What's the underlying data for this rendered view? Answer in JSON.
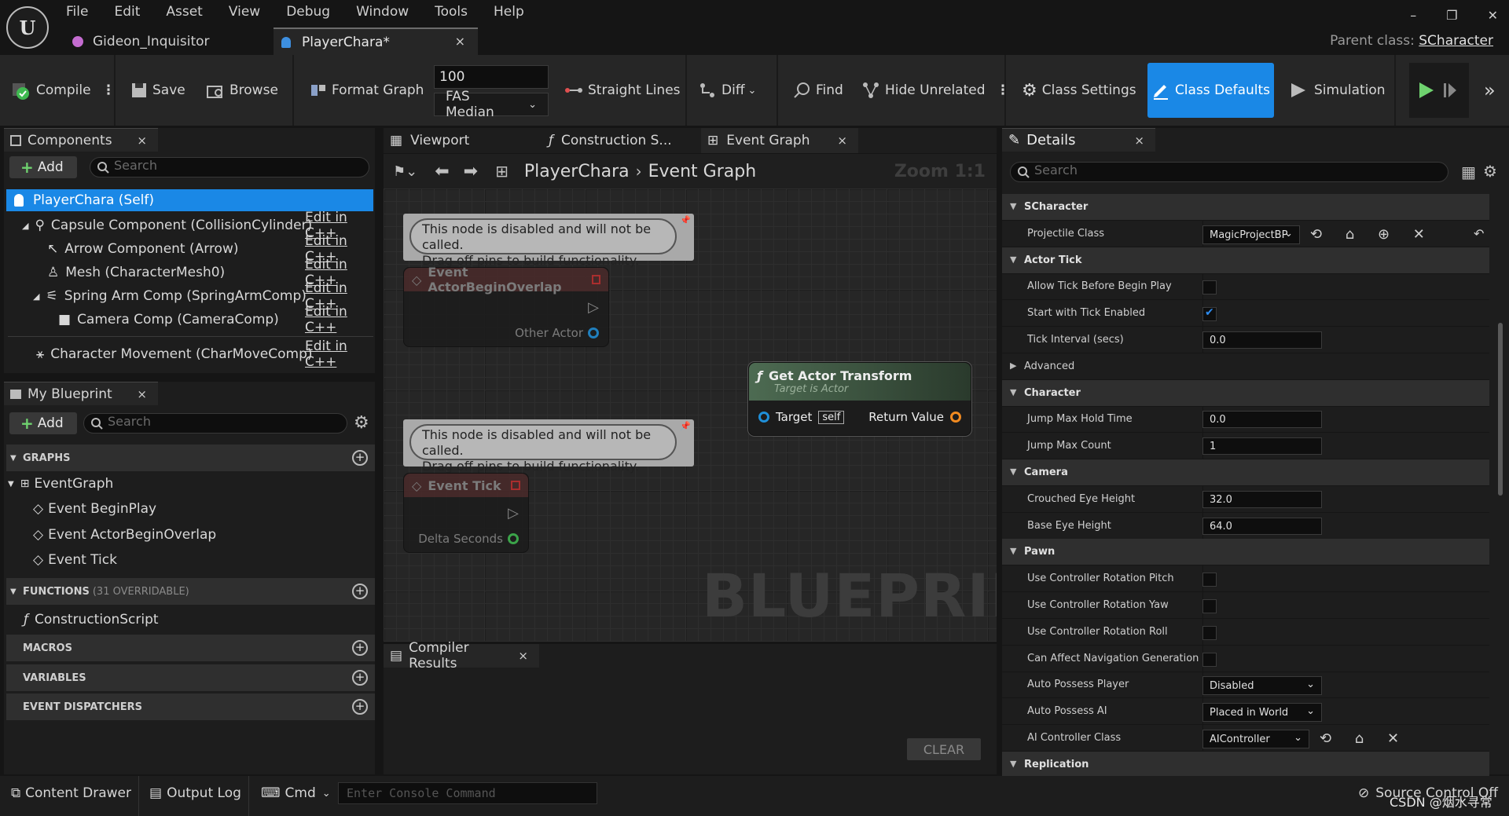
{
  "menu": [
    "File",
    "Edit",
    "Asset",
    "View",
    "Debug",
    "Window",
    "Tools",
    "Help"
  ],
  "tabs": {
    "project": "Gideon_Inquisitor",
    "asset": "PlayerChara*",
    "close_glyph": "×"
  },
  "parent_class": {
    "label": "Parent class:",
    "value": "SCharacter"
  },
  "window_controls": [
    "–",
    "❐",
    "✕"
  ],
  "toolbar": {
    "compile": "Compile",
    "save": "Save",
    "browse": "Browse",
    "format_graph": "Format Graph",
    "zoom_value": "100",
    "fas_select": "FAS Median",
    "straight_lines": "Straight Lines",
    "diff": "Diff",
    "find": "Find",
    "hide_unrelated": "Hide Unrelated",
    "class_settings": "Class Settings",
    "class_defaults": "Class Defaults",
    "simulation": "Simulation"
  },
  "components": {
    "title": "Components",
    "add": "Add",
    "search_placeholder": "Search",
    "self": "PlayerChara (Self)",
    "edit_label": "Edit in C++",
    "items": [
      "Capsule Component (CollisionCylinder)",
      "Arrow Component (Arrow)",
      "Mesh (CharacterMesh0)",
      "Spring Arm Comp (SpringArmComp)",
      "Camera Comp (CameraComp)",
      "Character Movement (CharMoveComp)"
    ]
  },
  "my_blueprint": {
    "title": "My Blueprint",
    "add": "Add",
    "search_placeholder": "Search",
    "graphs_label": "GRAPHS",
    "event_graph": "EventGraph",
    "events": [
      "Event BeginPlay",
      "Event ActorBeginOverlap",
      "Event Tick"
    ],
    "functions_label": "FUNCTIONS",
    "functions_sub": "(31 OVERRIDABLE)",
    "construction_script": "ConstructionScript",
    "macros_label": "MACROS",
    "variables_label": "VARIABLES",
    "dispatchers_label": "EVENT DISPATCHERS"
  },
  "graph": {
    "tabs": [
      "Viewport",
      "Construction S...",
      "Event Graph"
    ],
    "breadcrumb_root": "PlayerChara",
    "breadcrumb_leaf": "Event Graph",
    "zoom": "Zoom 1:1",
    "disabled_comment": "This node is disabled and will not be called.\nDrag off pins to build functionality.",
    "node_overlap": {
      "title": "Event ActorBeginOverlap",
      "pin": "Other Actor"
    },
    "node_tick": {
      "title": "Event Tick",
      "pin": "Delta Seconds"
    },
    "node_transform": {
      "title": "Get Actor Transform",
      "subtitle": "Target is Actor",
      "target": "Target",
      "self": "self",
      "return": "Return Value"
    },
    "watermark": "BLUEPRINT"
  },
  "compiler": {
    "title": "Compiler Results",
    "clear": "CLEAR"
  },
  "details": {
    "title": "Details",
    "search_placeholder": "Search",
    "rows": [
      {
        "type": "cat",
        "label": "SCharacter"
      },
      {
        "type": "select",
        "label": "Projectile Class",
        "value": "MagicProjectBP",
        "icons": "⟲ ⌂ ⊕ ✕",
        "reset": "↶"
      },
      {
        "type": "cat",
        "label": "Actor Tick"
      },
      {
        "type": "check",
        "label": "Allow Tick Before Begin Play",
        "checked": false
      },
      {
        "type": "check",
        "label": "Start with Tick Enabled",
        "checked": true
      },
      {
        "type": "input",
        "label": "Tick Interval (secs)",
        "value": "0.0"
      },
      {
        "type": "sub",
        "label": "Advanced"
      },
      {
        "type": "cat",
        "label": "Character"
      },
      {
        "type": "input",
        "label": "Jump Max Hold Time",
        "value": "0.0"
      },
      {
        "type": "input",
        "label": "Jump Max Count",
        "value": "1"
      },
      {
        "type": "cat",
        "label": "Camera"
      },
      {
        "type": "input",
        "label": "Crouched Eye Height",
        "value": "32.0"
      },
      {
        "type": "input",
        "label": "Base Eye Height",
        "value": "64.0"
      },
      {
        "type": "cat",
        "label": "Pawn"
      },
      {
        "type": "check",
        "label": "Use Controller Rotation Pitch",
        "checked": false
      },
      {
        "type": "check",
        "label": "Use Controller Rotation Yaw",
        "checked": false
      },
      {
        "type": "check",
        "label": "Use Controller Rotation Roll",
        "checked": false
      },
      {
        "type": "check",
        "label": "Can Affect Navigation Generation",
        "checked": false
      },
      {
        "type": "select",
        "label": "Auto Possess Player",
        "value": "Disabled"
      },
      {
        "type": "select",
        "label": "Auto Possess AI",
        "value": "Placed in World"
      },
      {
        "type": "select",
        "label": "AI Controller Class",
        "value": "AIController",
        "icons": "⟲ ⌂ ✕"
      },
      {
        "type": "cat",
        "label": "Replication"
      }
    ]
  },
  "statusbar": {
    "content_drawer": "Content Drawer",
    "output_log": "Output Log",
    "cmd": "Cmd",
    "console_placeholder": "Enter Console Command",
    "source_control": "Source Control Off",
    "watermark_text": "CSDN @烟水寻常"
  },
  "colors": {
    "accent": "#1a88e6",
    "panel": "#1d1d1d",
    "toolbar": "#262626",
    "play": "#6fd26f"
  }
}
